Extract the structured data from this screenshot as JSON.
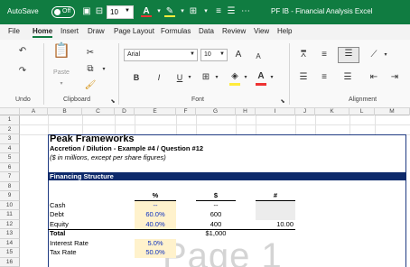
{
  "titlebar": {
    "autosave_label": "AutoSave",
    "autosave_state": "Off",
    "font_size": "10",
    "doc_title": "PF IB - Financial Analysis Excel",
    "bg": "#107c41"
  },
  "menu": {
    "tabs": [
      "File",
      "Home",
      "Insert",
      "Draw",
      "Page Layout",
      "Formulas",
      "Data",
      "Review",
      "View",
      "Help"
    ],
    "active": "Home"
  },
  "ribbon": {
    "undo_group": "Undo",
    "clipboard_group": "Clipboard",
    "paste_label": "Paste",
    "font_group": "Font",
    "font_name": "Arial",
    "font_size": "10",
    "bold": "B",
    "italic": "I",
    "underline": "U",
    "grow_font": "A",
    "shrink_font": "A",
    "alignment_group": "Alignment"
  },
  "sheet": {
    "columns": [
      "A",
      "B",
      "C",
      "D",
      "E",
      "F",
      "G",
      "H",
      "I",
      "J",
      "K",
      "L",
      "M"
    ],
    "rows": [
      "1",
      "2",
      "3",
      "4",
      "5",
      "6",
      "7",
      "8",
      "9",
      "10",
      "11",
      "12",
      "13",
      "14",
      "15",
      "16"
    ],
    "company": "Peak Frameworks",
    "subtitle": "Accretion / Dilution - Example #4 / Question #12",
    "units_note": "($ in millions, except per share figures)",
    "section_header": "Financing Structure",
    "col_pct": "%",
    "col_dollar": "$",
    "col_hash": "#",
    "cash_label": "Cash",
    "cash_pct": "--",
    "cash_dollar": "--",
    "debt_label": "Debt",
    "debt_pct": "60.0%",
    "debt_dollar": "600",
    "equity_label": "Equity",
    "equity_pct": "40.0%",
    "equity_dollar": "400",
    "equity_hash": "10.00",
    "total_label": "Total",
    "total_dollar": "$1,000",
    "interest_label": "Interest Rate",
    "interest_value": "5.0%",
    "tax_label": "Tax Rate",
    "tax_value": "50.0%",
    "watermark": "Page 1",
    "section_bg": "#0d2a6b",
    "input_bg": "#fff2cc"
  }
}
